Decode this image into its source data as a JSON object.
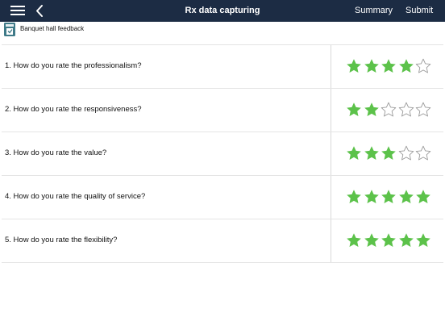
{
  "navbar": {
    "title": "Rx data capturing",
    "summary_label": "Summary",
    "submit_label": "Submit",
    "menu_icon": "hamburger-menu-icon",
    "back_icon": "chevron-left-icon"
  },
  "form": {
    "title": "Banquet hall feedback",
    "icon": "form-document-icon"
  },
  "rating_max": 5,
  "colors": {
    "navbar": "#1c2c44",
    "star_filled": "#5cc24a",
    "star_empty": "#9a9a9a"
  },
  "questions": [
    {
      "text": "1.  How do you rate the professionalism?",
      "rating": 4
    },
    {
      "text": "2.  How do you rate the responsiveness?",
      "rating": 2
    },
    {
      "text": "3.  How do you rate the value?",
      "rating": 3
    },
    {
      "text": "4.  How do you rate the quality of service?",
      "rating": 5
    },
    {
      "text": "5.  How do you rate the flexibility?",
      "rating": 5
    }
  ]
}
